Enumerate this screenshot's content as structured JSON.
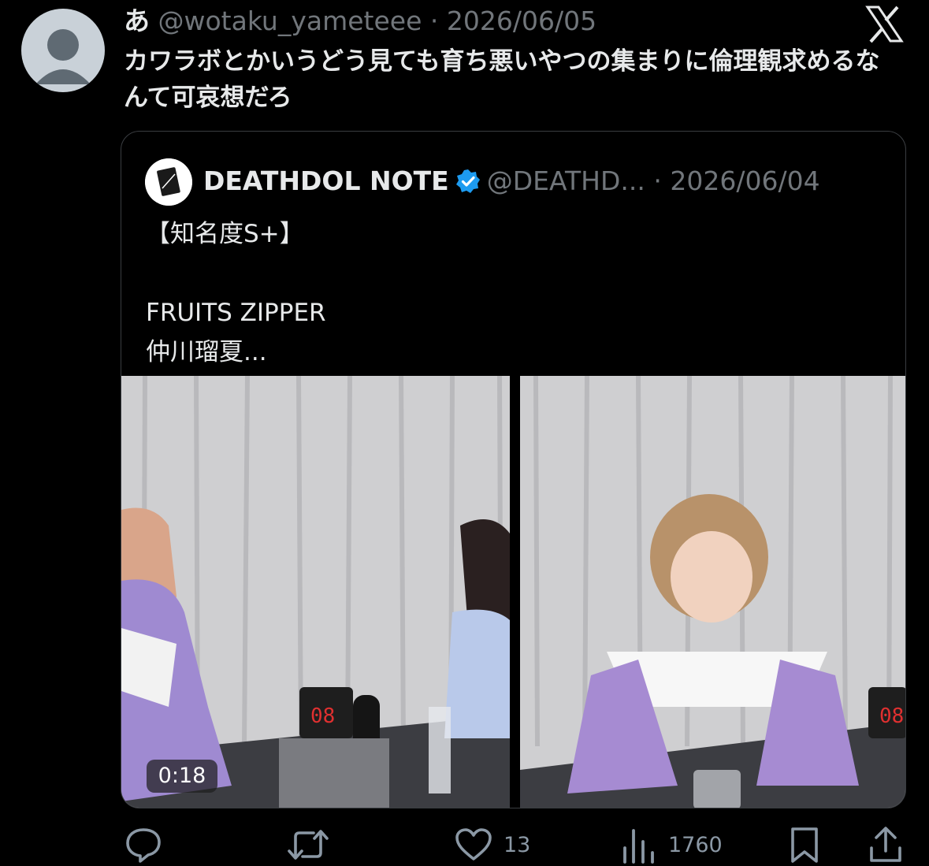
{
  "post": {
    "author_name": "あ",
    "author_handle": "@wotaku_yameteee",
    "separator": "·",
    "date": "2026/06/05",
    "text": "カワラボとかいうどう見ても育ち悪いやつの集まりに倫理観求めるなんて可哀想だろ"
  },
  "quoted": {
    "author_name": "DEATHDOL NOTE",
    "author_handle": "@DEATHD...",
    "separator": "·",
    "date": "2026/06/04",
    "lines": [
      "【知名度S+】",
      "",
      "FRUITS ZIPPER",
      "仲川瑠夏..."
    ],
    "video_duration": "0:18"
  },
  "actions": {
    "likes": "13",
    "views": "1760"
  },
  "icons": {
    "logo": "x-logo-icon",
    "reply": "reply-icon",
    "repost": "repost-icon",
    "like": "heart-icon",
    "views": "views-icon",
    "bookmark": "bookmark-icon",
    "share": "share-icon",
    "verified": "verified-badge-icon"
  },
  "colors": {
    "background": "#000000",
    "text": "#e7e9ea",
    "muted": "#71767b",
    "verified": "#1d9bf0"
  }
}
